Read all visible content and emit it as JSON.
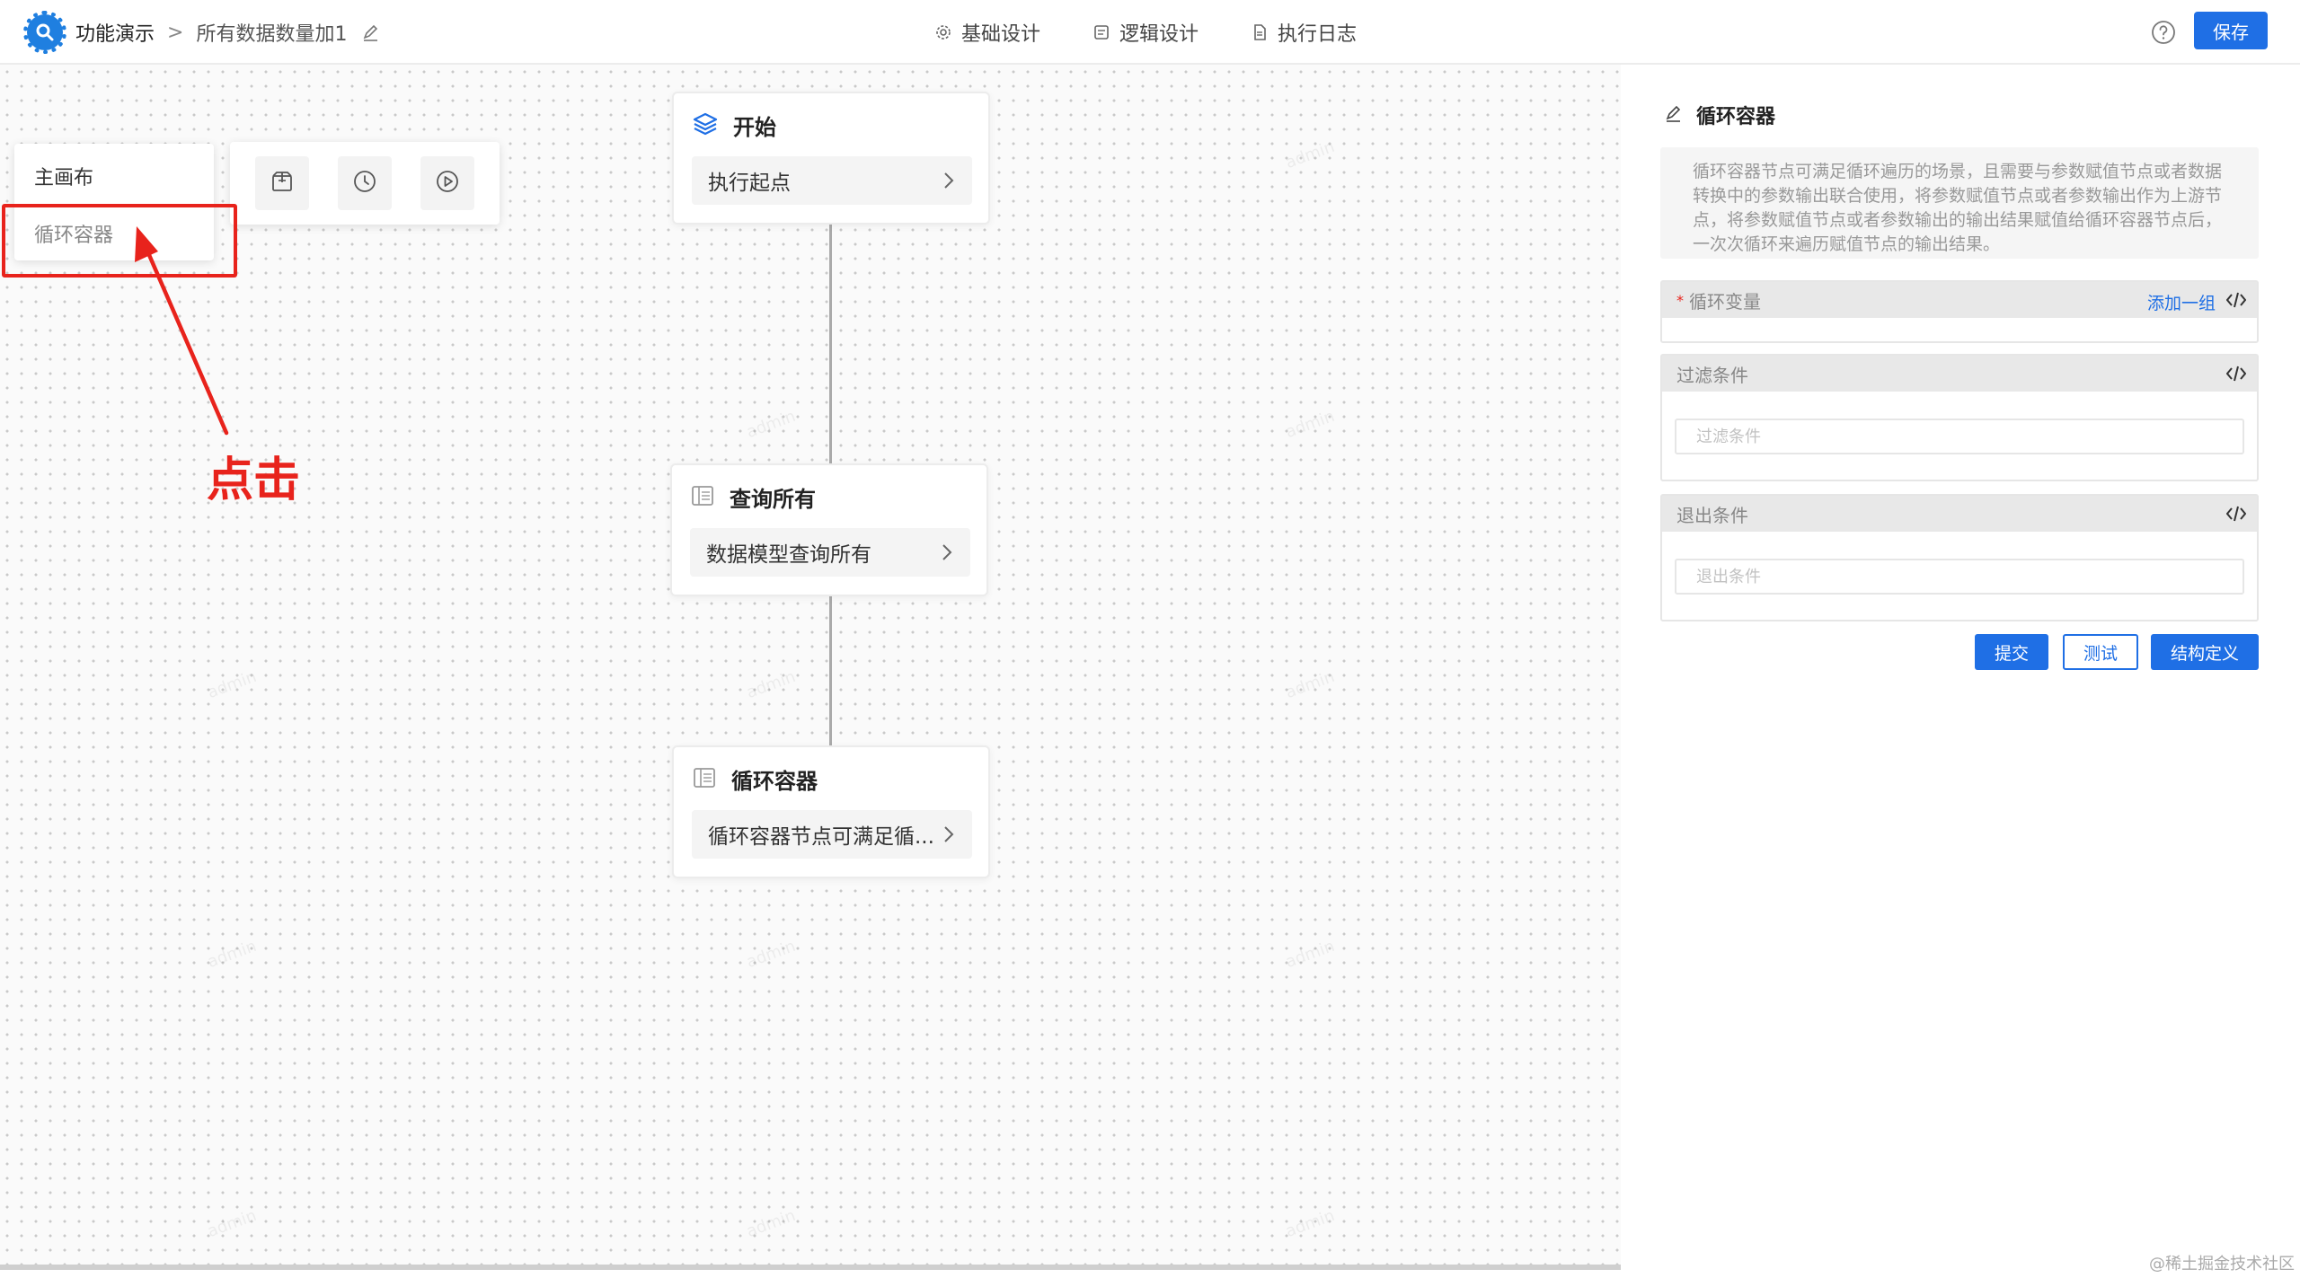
{
  "header": {
    "app_name": "功能演示",
    "separator": ">",
    "page_name": "所有数据数量加1",
    "tabs": [
      {
        "label": "基础设计",
        "icon": "gear-icon"
      },
      {
        "label": "逻辑设计",
        "icon": "logic-doc-icon"
      },
      {
        "label": "执行日志",
        "icon": "log-file-icon"
      }
    ],
    "save_label": "保存",
    "accent": "#1f6fe5"
  },
  "canvas_menu": {
    "items": [
      {
        "label": "主画布"
      },
      {
        "label": "循环容器"
      }
    ]
  },
  "toolbar": {
    "tools": [
      {
        "icon": "package-icon"
      },
      {
        "icon": "clock-icon"
      },
      {
        "icon": "play-icon"
      }
    ]
  },
  "annotation": {
    "text": "点击",
    "color": "#e8231c"
  },
  "nodes": [
    {
      "title": "开始",
      "body": "执行起点",
      "icon": "layers-icon"
    },
    {
      "title": "查询所有",
      "body": "数据模型查询所有",
      "icon": "table-icon"
    },
    {
      "title": "循环容器",
      "body": "循环容器节点可满足循...",
      "icon": "table-icon"
    }
  ],
  "watermark_text": "admin",
  "panel": {
    "title": "循环容器",
    "description": "循环容器节点可满足循环遍历的场景，且需要与参数赋值节点或者数据转换中的参数输出联合使用，将参数赋值节点或者参数输出作为上游节点，将参数赋值节点或者参数输出的输出结果赋值给循环容器节点后，一次次循环来遍历赋值节点的输出结果。",
    "loop_var": {
      "label": "循环变量",
      "required_mark": "*",
      "add_label": "添加一组"
    },
    "filter": {
      "label": "过滤条件",
      "placeholder": "过滤条件"
    },
    "exit": {
      "label": "退出条件",
      "placeholder": "退出条件"
    },
    "buttons": {
      "submit": "提交",
      "test": "测试",
      "struct": "结构定义"
    }
  },
  "site_mark": "@稀土掘金技术社区"
}
